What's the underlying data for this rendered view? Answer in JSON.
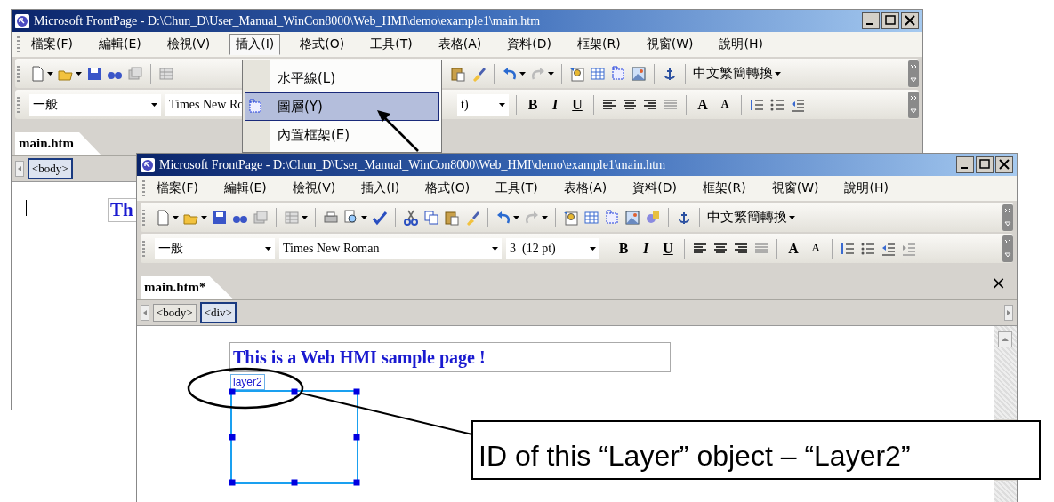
{
  "back_window": {
    "title": "Microsoft FrontPage - D:\\Chun_D\\User_Manual_WinCon8000\\Web_HMI\\demo\\example1\\main.htm",
    "menu": [
      {
        "label": "檔案(F)",
        "open": false
      },
      {
        "label": "編輯(E)",
        "open": false
      },
      {
        "label": "檢視(V)",
        "open": false
      },
      {
        "label": "插入(I)",
        "open": true
      },
      {
        "label": "格式(O)",
        "open": false
      },
      {
        "label": "工具(T)",
        "open": false
      },
      {
        "label": "表格(A)",
        "open": false
      },
      {
        "label": "資料(D)",
        "open": false
      },
      {
        "label": "框架(R)",
        "open": false
      },
      {
        "label": "視窗(W)",
        "open": false
      },
      {
        "label": "說明(H)",
        "open": false
      }
    ],
    "convert_button": "中文繁簡轉換",
    "format_bar": {
      "style": "一般",
      "font": "Times New Ro",
      "size": "t)",
      "style_buttons": [
        "B",
        "I",
        "U"
      ],
      "size_buttons": [
        "A",
        "A"
      ]
    },
    "tab": "main.htm",
    "breadcrumbs": [
      {
        "label": "<body>",
        "selected": true
      }
    ],
    "editor_text": "Th"
  },
  "insert_menu": [
    {
      "label": "水平線(L)",
      "selected": false
    },
    {
      "label": "圖層(Y)",
      "selected": true
    },
    {
      "label": "內置框架(E)",
      "selected": false
    }
  ],
  "front_window": {
    "title": "Microsoft FrontPage - D:\\Chun_D\\User_Manual_WinCon8000\\Web_HMI\\demo\\example1\\main.htm",
    "menu": [
      "檔案(F)",
      "編輯(E)",
      "檢視(V)",
      "插入(I)",
      "格式(O)",
      "工具(T)",
      "表格(A)",
      "資料(D)",
      "框架(R)",
      "視窗(W)",
      "說明(H)"
    ],
    "convert_button": "中文繁簡轉換",
    "format_bar": {
      "style": "一般",
      "font": "Times New Roman",
      "size": "3  (12 pt)",
      "style_buttons": [
        "B",
        "I",
        "U"
      ],
      "size_buttons": [
        "A",
        "A"
      ]
    },
    "tab": "main.htm*",
    "close": "×",
    "breadcrumbs": [
      {
        "label": "<body>",
        "selected": false
      },
      {
        "label": "<div>",
        "selected": true
      }
    ],
    "page_text": "This is a Web HMI sample page !",
    "layer_label": "layer2"
  },
  "callout": "ID of this “Layer” object – “Layer2”"
}
